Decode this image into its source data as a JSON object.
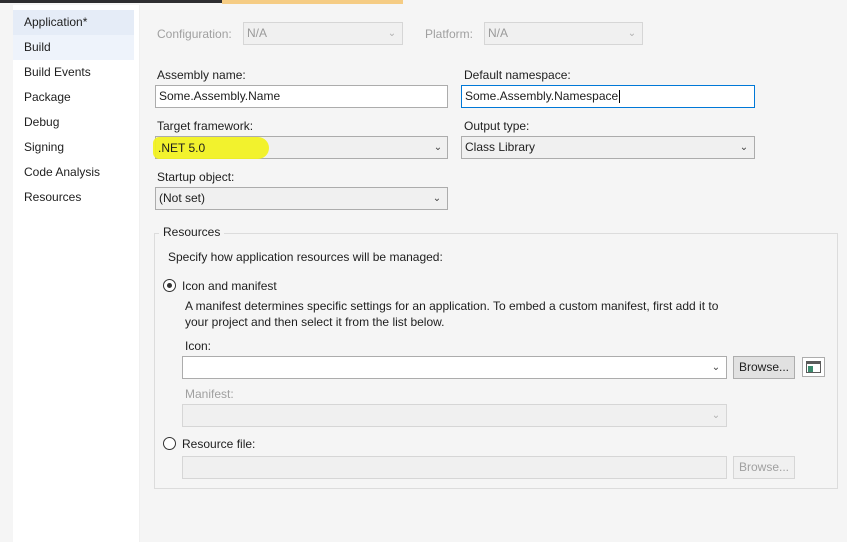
{
  "sidebar": {
    "items": [
      {
        "label": "Application*",
        "selected": true
      },
      {
        "label": "Build",
        "hover": true
      },
      {
        "label": "Build Events"
      },
      {
        "label": "Package"
      },
      {
        "label": "Debug"
      },
      {
        "label": "Signing"
      },
      {
        "label": "Code Analysis"
      },
      {
        "label": "Resources"
      }
    ]
  },
  "toolbar": {
    "configuration_label": "Configuration:",
    "configuration_value": "N/A",
    "platform_label": "Platform:",
    "platform_value": "N/A"
  },
  "form": {
    "assembly_name_label": "Assembly name:",
    "assembly_name_value": "Some.Assembly.Name",
    "default_namespace_label": "Default namespace:",
    "default_namespace_value": "Some.Assembly.Namespace",
    "target_framework_label": "Target framework:",
    "target_framework_value": ".NET 5.0",
    "output_type_label": "Output type:",
    "output_type_value": "Class Library",
    "startup_object_label": "Startup object:",
    "startup_object_value": "(Not set)"
  },
  "resources": {
    "group_title": "Resources",
    "description": "Specify how application resources will be managed:",
    "icon_manifest_label": "Icon and manifest",
    "icon_manifest_selected": true,
    "help_line1": "A manifest determines specific settings for an application. To embed a custom manifest, first add it to",
    "help_line2": "your project and then select it from the list below.",
    "icon_label": "Icon:",
    "icon_value": "",
    "browse_label": "Browse...",
    "manifest_label": "Manifest:",
    "manifest_value": "",
    "resource_file_label": "Resource file:",
    "resource_file_selected": false,
    "resource_file_value": "",
    "browse2_label": "Browse..."
  },
  "colors": {
    "highlight": "#f2f21c",
    "selected_item": "#e5ecf7",
    "focus_border": "#0078d7",
    "tab_accent": "#f5cc84"
  }
}
